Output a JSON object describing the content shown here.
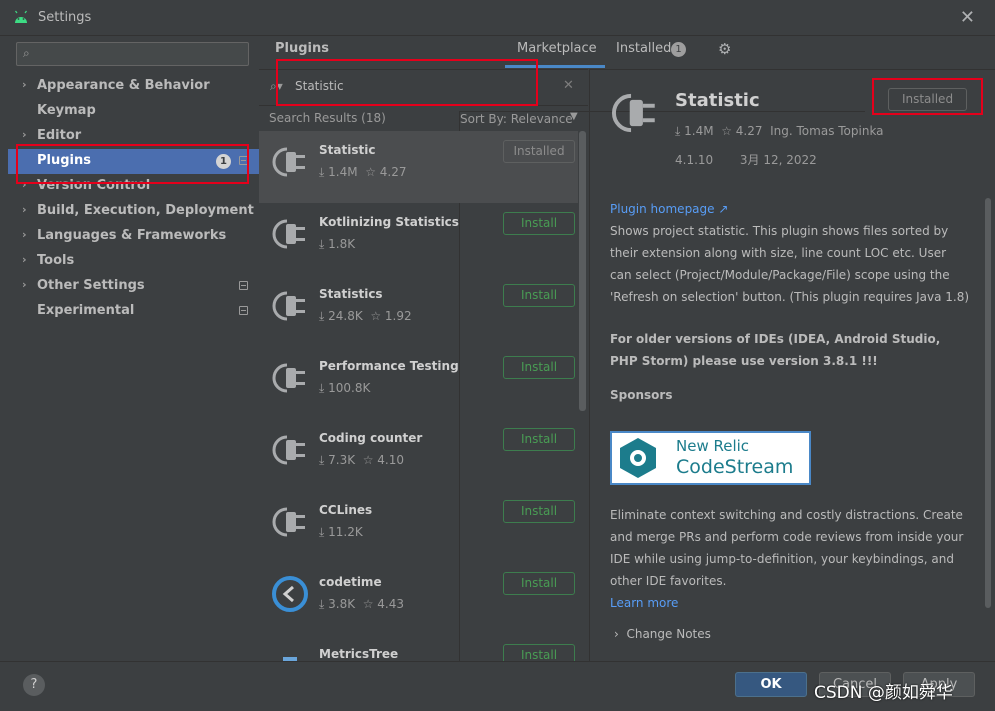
{
  "window": {
    "title": "Settings",
    "close_glyph": "✕"
  },
  "sidebar": {
    "search_placeholder": "",
    "items": [
      {
        "label": "Appearance & Behavior",
        "arrow": "›",
        "selected": false
      },
      {
        "label": "Keymap",
        "arrow": "",
        "selected": false
      },
      {
        "label": "Editor",
        "arrow": "›",
        "selected": false
      },
      {
        "label": "Plugins",
        "arrow": "",
        "selected": true,
        "badge": "1"
      },
      {
        "label": "Version Control",
        "arrow": "›",
        "selected": false
      },
      {
        "label": "Build, Execution, Deployment",
        "arrow": "›",
        "selected": false
      },
      {
        "label": "Languages & Frameworks",
        "arrow": "›",
        "selected": false
      },
      {
        "label": "Tools",
        "arrow": "›",
        "selected": false
      },
      {
        "label": "Other Settings",
        "arrow": "›",
        "selected": false
      },
      {
        "label": "Experimental",
        "arrow": "",
        "selected": false
      }
    ]
  },
  "header": {
    "title": "Plugins",
    "tabs": [
      {
        "label": "Marketplace",
        "active": true
      },
      {
        "label": "Installed",
        "active": false,
        "badge": "1"
      }
    ]
  },
  "search": {
    "value": "Statistic",
    "results_label": "Search Results (18)",
    "sort_label": "Sort By: Relevance"
  },
  "plugins": [
    {
      "name": "Statistic",
      "downloads": "1.4M",
      "rating": "4.27",
      "button": "Installed",
      "installed": true,
      "icon": "plug-icon"
    },
    {
      "name": "Kotlinizing Statistics",
      "downloads": "1.8K",
      "rating": "",
      "button": "Install",
      "installed": false,
      "icon": "plug-icon"
    },
    {
      "name": "Statistics",
      "downloads": "24.8K",
      "rating": "1.92",
      "button": "Install",
      "installed": false,
      "icon": "plug-icon"
    },
    {
      "name": "Performance Testing",
      "downloads": "100.8K",
      "rating": "",
      "button": "Install",
      "installed": false,
      "icon": "plug-icon"
    },
    {
      "name": "Coding counter",
      "downloads": "7.3K",
      "rating": "4.10",
      "button": "Install",
      "installed": false,
      "icon": "plug-icon"
    },
    {
      "name": "CCLines",
      "downloads": "11.2K",
      "rating": "",
      "button": "Install",
      "installed": false,
      "icon": "plug-icon"
    },
    {
      "name": "codetime",
      "downloads": "3.8K",
      "rating": "4.43",
      "button": "Install",
      "installed": false,
      "icon": "codetime-icon"
    },
    {
      "name": "MetricsTree",
      "downloads": "",
      "rating": "",
      "button": "Install",
      "installed": false,
      "icon": "metricstree-icon"
    }
  ],
  "detail": {
    "name": "Statistic",
    "downloads": "1.4M",
    "rating": "4.27",
    "author": "Ing. Tomas Topinka",
    "version": "4.1.10",
    "date": "3月 12, 2022",
    "installed_label": "Installed",
    "homepage_label": "Plugin homepage ↗",
    "description": "Shows project statistic. This plugin shows files sorted by their extension along with size, line count LOC etc. User can select (Project/Module/Package/File) scope using the 'Refresh on selection' button. (This plugin requires Java 1.8)",
    "notice": "For older versions of IDEs (IDEA, Android Studio, PHP Storm) please use version 3.8.1 !!!",
    "sponsors_label": "Sponsors",
    "sponsor_line1": "New Relic",
    "sponsor_line2": "CodeStream",
    "sponsor_text": "Eliminate context switching and costly distractions. Create and merge PRs and perform code reviews from inside your IDE while using jump-to-definition, your keybindings, and other IDE favorites.",
    "learn_more": "Learn more",
    "change_notes": "Change Notes"
  },
  "footer": {
    "help": "?",
    "ok": "OK",
    "cancel": "Cancel",
    "apply": "Apply"
  },
  "watermark": "CSDN @颜如舜华",
  "colors": {
    "accent": "#4b6eaf",
    "install_green": "#499c54",
    "link": "#589df6",
    "annotation_red": "#e5001b"
  }
}
